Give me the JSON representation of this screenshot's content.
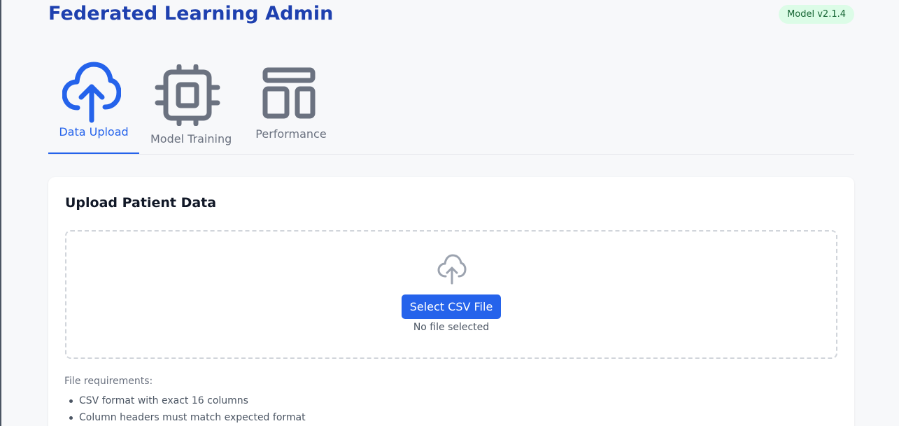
{
  "app": {
    "title": "Federated Learning Admin",
    "version_badge": "Model v2.1.4"
  },
  "tabs": [
    {
      "label": "Data Upload",
      "icon": "cloud-upload-icon",
      "active": true
    },
    {
      "label": "Model Training",
      "icon": "cpu-chip-icon",
      "active": false
    },
    {
      "label": "Performance",
      "icon": "layout-panels-icon",
      "active": false
    }
  ],
  "upload_card": {
    "title": "Upload Patient Data",
    "dropzone": {
      "icon": "cloud-upload-icon",
      "button_label": "Select CSV File",
      "status_text": "No file selected"
    },
    "requirements_title": "File requirements:",
    "requirements": [
      "CSV format with exact 16 columns",
      "Column headers must match expected format"
    ]
  },
  "colors": {
    "brand": "#1e40af",
    "accent": "#2563eb",
    "inactive": "#6b7280",
    "badge_bg": "#dcfce7",
    "badge_text": "#166534"
  }
}
